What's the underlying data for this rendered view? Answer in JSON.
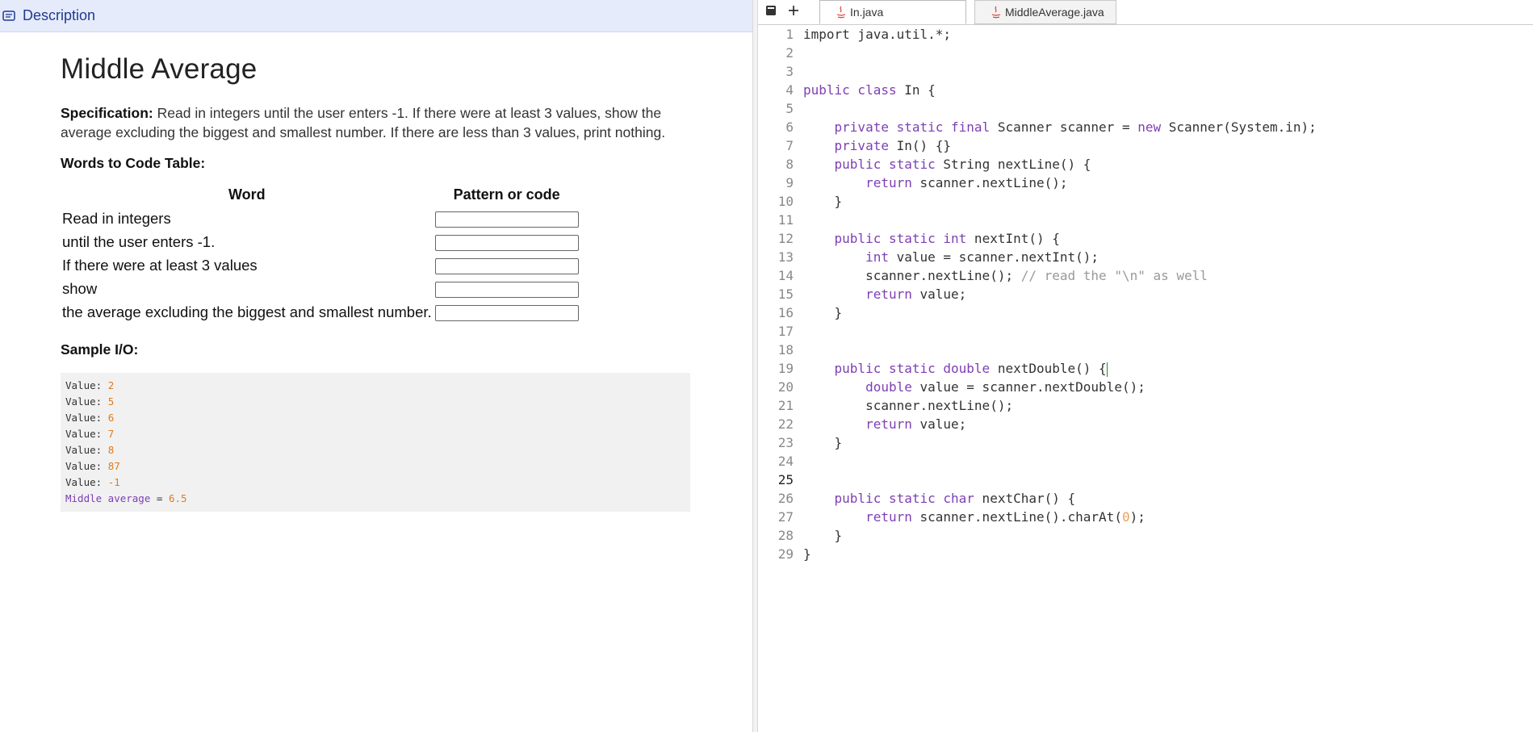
{
  "description_header": {
    "label": "Description",
    "icon": "message-square-icon"
  },
  "problem": {
    "title": "Middle Average",
    "spec_label": "Specification:",
    "spec_text": "Read in integers until the user enters -1. If there were at least 3 values, show the average excluding the biggest and smallest number. If there are less than 3 values, print nothing.",
    "words_heading": "Words to Code Table:",
    "table_headers": [
      "Word",
      "Pattern or code"
    ],
    "table_rows": [
      "Read in integers",
      "until the user enters -1.",
      "If there were at least 3 values",
      "show",
      "the average excluding the biggest and smallest number."
    ],
    "sample_heading": "Sample I/O:",
    "sample_io": [
      {
        "prompt": "Value: ",
        "value": "2"
      },
      {
        "prompt": "Value: ",
        "value": "5"
      },
      {
        "prompt": "Value: ",
        "value": "6"
      },
      {
        "prompt": "Value: ",
        "value": "7"
      },
      {
        "prompt": "Value: ",
        "value": "8"
      },
      {
        "prompt": "Value: ",
        "value": "87"
      },
      {
        "prompt": "Value: ",
        "value": "-1"
      }
    ],
    "sample_result": {
      "label": "Middle average",
      "eq": " = ",
      "value": "6.5"
    }
  },
  "editor": {
    "tabs": [
      {
        "label": "In.java",
        "active": true
      },
      {
        "label": "MiddleAverage.java",
        "active": false
      }
    ],
    "current_line": 25,
    "lines": [
      [
        [
          "txt",
          "import java.util.*;"
        ]
      ],
      [],
      [],
      [
        [
          "kw",
          "public class"
        ],
        [
          "txt",
          " In {"
        ]
      ],
      [],
      [
        [
          "txt",
          "    "
        ],
        [
          "kw",
          "private static final"
        ],
        [
          "txt",
          " Scanner scanner = "
        ],
        [
          "kw",
          "new"
        ],
        [
          "txt",
          " Scanner(System.in);"
        ]
      ],
      [
        [
          "txt",
          "    "
        ],
        [
          "kw",
          "private"
        ],
        [
          "txt",
          " In() {}"
        ]
      ],
      [
        [
          "txt",
          "    "
        ],
        [
          "kw",
          "public static"
        ],
        [
          "txt",
          " String nextLine() {"
        ]
      ],
      [
        [
          "txt",
          "        "
        ],
        [
          "kw",
          "return"
        ],
        [
          "txt",
          " scanner.nextLine();"
        ]
      ],
      [
        [
          "txt",
          "    }"
        ]
      ],
      [],
      [
        [
          "txt",
          "    "
        ],
        [
          "kw",
          "public static int"
        ],
        [
          "txt",
          " nextInt() {"
        ]
      ],
      [
        [
          "txt",
          "        "
        ],
        [
          "kw",
          "int"
        ],
        [
          "txt",
          " value = scanner.nextInt();"
        ]
      ],
      [
        [
          "txt",
          "        scanner.nextLine(); "
        ],
        [
          "cm",
          "// read the \"\\n\" as well"
        ]
      ],
      [
        [
          "txt",
          "        "
        ],
        [
          "kw",
          "return"
        ],
        [
          "txt",
          " value;"
        ]
      ],
      [
        [
          "txt",
          "    }"
        ]
      ],
      [],
      [],
      [
        [
          "txt",
          "    "
        ],
        [
          "kw",
          "public static double"
        ],
        [
          "txt",
          " nextDouble() {"
        ],
        [
          "caret",
          ""
        ]
      ],
      [
        [
          "txt",
          "        "
        ],
        [
          "kw",
          "double"
        ],
        [
          "txt",
          " value = scanner.nextDouble();"
        ]
      ],
      [
        [
          "txt",
          "        scanner.nextLine();"
        ]
      ],
      [
        [
          "txt",
          "        "
        ],
        [
          "kw",
          "return"
        ],
        [
          "txt",
          " value;"
        ]
      ],
      [
        [
          "txt",
          "    }"
        ]
      ],
      [],
      [],
      [
        [
          "txt",
          "    "
        ],
        [
          "kw",
          "public static char"
        ],
        [
          "txt",
          " nextChar() {"
        ]
      ],
      [
        [
          "txt",
          "        "
        ],
        [
          "kw",
          "return"
        ],
        [
          "txt",
          " scanner.nextLine().charAt("
        ],
        [
          "lit",
          "0"
        ],
        [
          "txt",
          ");"
        ]
      ],
      [
        [
          "txt",
          "    }"
        ]
      ],
      [
        [
          "txt",
          "}"
        ]
      ]
    ]
  }
}
